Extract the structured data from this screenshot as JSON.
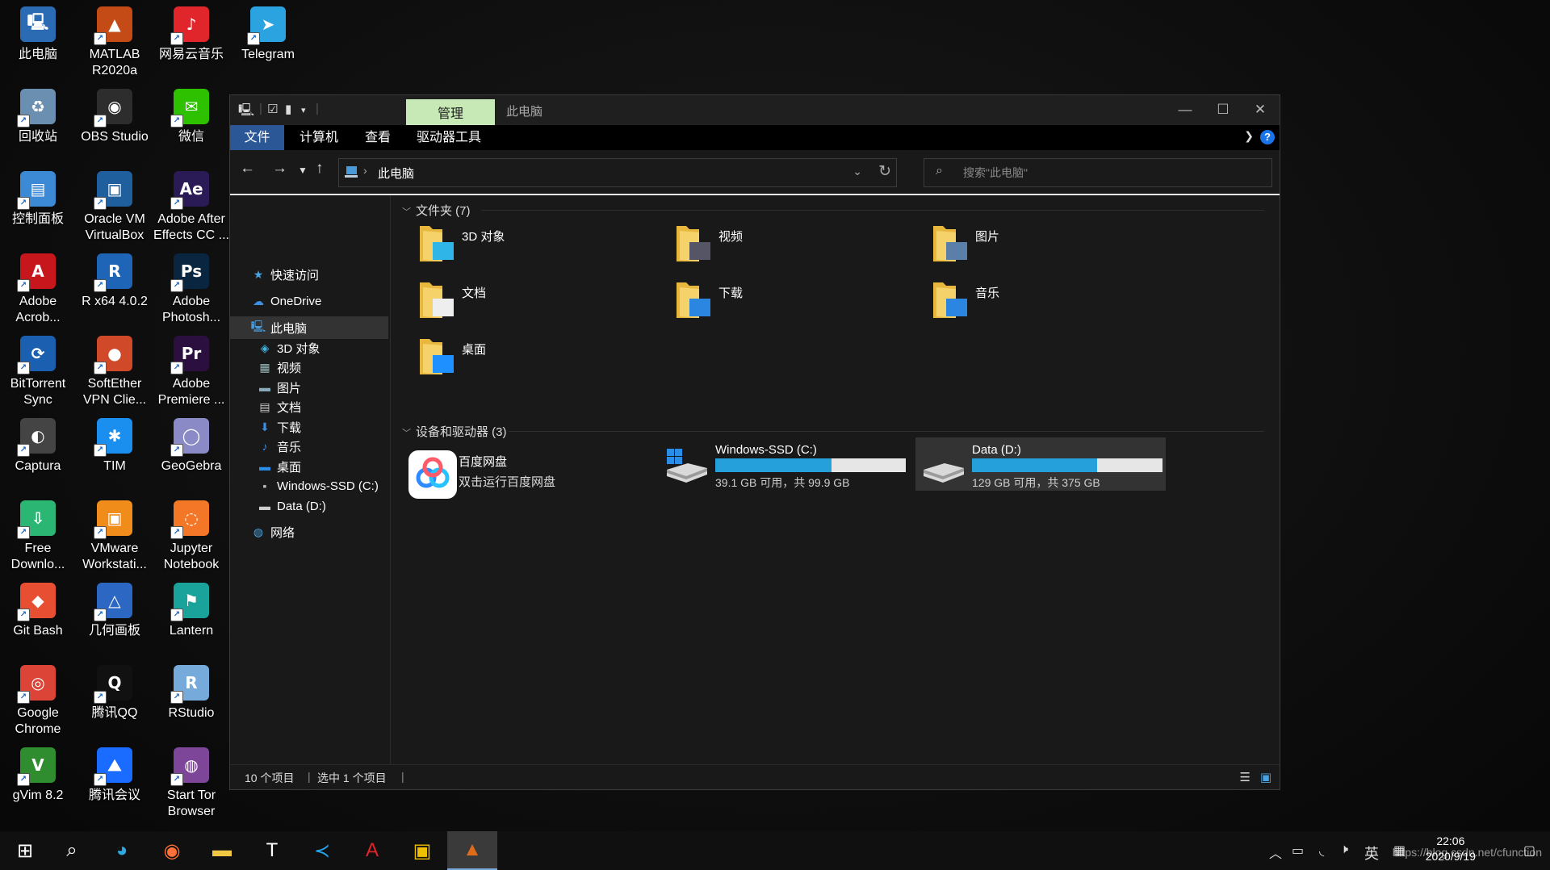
{
  "desktop": {
    "icons": [
      {
        "label": "此电脑",
        "icon": "this-pc-icon"
      },
      {
        "label": "MATLAB\nR2020a",
        "icon": "matlab-icon"
      },
      {
        "label": "网易云音乐",
        "icon": "netease-music-icon"
      },
      {
        "label": "Telegram",
        "icon": "telegram-icon"
      },
      {
        "label": "回收站",
        "icon": "recycle-bin-icon"
      },
      {
        "label": "OBS Studio",
        "icon": "obs-icon"
      },
      {
        "label": "微信",
        "icon": "wechat-icon"
      },
      {
        "label": "控制面板",
        "icon": "control-panel-icon"
      },
      {
        "label": "Oracle VM\nVirtualBox",
        "icon": "virtualbox-icon"
      },
      {
        "label": "Adobe After\nEffects CC ...",
        "icon": "after-effects-icon"
      },
      {
        "label": "Adobe\nAcrob...",
        "icon": "acrobat-icon"
      },
      {
        "label": "R x64 4.0.2",
        "icon": "r-icon"
      },
      {
        "label": "Adobe\nPhotosh...",
        "icon": "photoshop-icon"
      },
      {
        "label": "BitTorrent\nSync",
        "icon": "bittorrent-sync-icon"
      },
      {
        "label": "SoftEther\nVPN Clie...",
        "icon": "softether-icon"
      },
      {
        "label": "Adobe\nPremiere ...",
        "icon": "premiere-icon"
      },
      {
        "label": "Captura",
        "icon": "captura-icon"
      },
      {
        "label": "TIM",
        "icon": "tim-icon"
      },
      {
        "label": "GeoGebra",
        "icon": "geogebra-icon"
      },
      {
        "label": "Free\nDownlo...",
        "icon": "free-download-manager-icon"
      },
      {
        "label": "VMware\nWorkstati...",
        "icon": "vmware-icon"
      },
      {
        "label": "Jupyter\nNotebook",
        "icon": "jupyter-icon"
      },
      {
        "label": "Git Bash",
        "icon": "git-bash-icon"
      },
      {
        "label": "几何画板",
        "icon": "sketchpad-icon"
      },
      {
        "label": "Lantern",
        "icon": "lantern-icon"
      },
      {
        "label": "Google\nChrome",
        "icon": "chrome-icon"
      },
      {
        "label": "腾讯QQ",
        "icon": "qq-icon"
      },
      {
        "label": "RStudio",
        "icon": "rstudio-icon"
      },
      {
        "label": "gVim 8.2",
        "icon": "gvim-icon"
      },
      {
        "label": "腾讯会议",
        "icon": "tencent-meeting-icon"
      },
      {
        "label": "Start Tor\nBrowser",
        "icon": "tor-browser-icon"
      }
    ]
  },
  "explorer": {
    "title": "此电脑",
    "contextual_tab": "管理",
    "ribbon_tabs": [
      "文件",
      "计算机",
      "查看",
      "驱动器工具"
    ],
    "address": {
      "crumb": "此电脑"
    },
    "search": {
      "placeholder": "搜索\"此电脑\""
    },
    "nav": [
      {
        "label": "快速访问",
        "icon": "star-icon"
      },
      {
        "label": "OneDrive",
        "icon": "cloud-icon"
      },
      {
        "label": "此电脑",
        "icon": "this-pc-icon"
      },
      {
        "label": "3D 对象",
        "icon": "3d-objects-icon"
      },
      {
        "label": "视频",
        "icon": "video-icon"
      },
      {
        "label": "图片",
        "icon": "pictures-icon"
      },
      {
        "label": "文档",
        "icon": "documents-icon"
      },
      {
        "label": "下载",
        "icon": "download-icon"
      },
      {
        "label": "音乐",
        "icon": "music-icon"
      },
      {
        "label": "桌面",
        "icon": "desktop-icon"
      },
      {
        "label": "Windows-SSD (C:)",
        "icon": "windows-drive-icon"
      },
      {
        "label": "Data (D:)",
        "icon": "drive-icon"
      },
      {
        "label": "网络",
        "icon": "network-icon"
      }
    ],
    "folders_header": "文件夹 (7)",
    "folders": [
      {
        "name": "3D 对象",
        "icon": "3d-objects-folder-icon"
      },
      {
        "name": "视频",
        "icon": "videos-folder-icon"
      },
      {
        "name": "图片",
        "icon": "pictures-folder-icon"
      },
      {
        "name": "文档",
        "icon": "documents-folder-icon"
      },
      {
        "name": "下载",
        "icon": "downloads-folder-icon"
      },
      {
        "name": "音乐",
        "icon": "music-folder-icon"
      },
      {
        "name": "桌面",
        "icon": "desktop-folder-icon"
      }
    ],
    "devices_header": "设备和驱动器 (3)",
    "baidu": {
      "name": "百度网盘",
      "sub": "双击运行百度网盘"
    },
    "drives": [
      {
        "name": "Windows-SSD (C:)",
        "info": "39.1 GB 可用，共 99.9 GB",
        "used_fraction": 0.61
      },
      {
        "name": "Data (D:)",
        "info": "129 GB 可用，共 375 GB",
        "used_fraction": 0.656
      }
    ],
    "status": {
      "count": "10 个项目",
      "selected": "选中 1 个项目"
    }
  },
  "taskbar": {
    "apps": [
      "start-icon",
      "search-icon",
      "edge-icon",
      "firefox-icon",
      "file-explorer-icon",
      "typora-icon",
      "vscode-icon",
      "acrobat-icon",
      "pdf-reader-icon",
      "matlab-icon"
    ],
    "ime": "英",
    "time": "22:06",
    "date": "2020/9/19"
  },
  "watermark": "https://blog.csdn.net/cfunction",
  "colors": {
    "accent": "#26a0da",
    "manage_tab": "#c7e9b6",
    "file_tab": "#2b5797",
    "selection": "#333333"
  }
}
